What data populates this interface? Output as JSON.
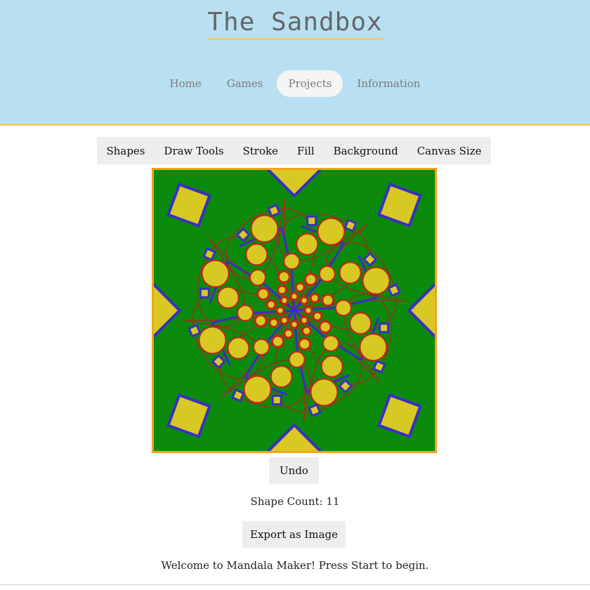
{
  "header": {
    "title": "The Sandbox",
    "nav": [
      {
        "label": "Home",
        "active": false
      },
      {
        "label": "Games",
        "active": false
      },
      {
        "label": "Projects",
        "active": true
      },
      {
        "label": "Information",
        "active": false
      }
    ]
  },
  "toolbar": {
    "items": [
      "Shapes",
      "Draw Tools",
      "Stroke",
      "Fill",
      "Background",
      "Canvas Size"
    ]
  },
  "canvas": {
    "background_color": "#0b8a0b",
    "fill_color": "#d8c823",
    "stroke_colors": [
      "#3a2fc0",
      "#c4231a",
      "#8b3a1a"
    ],
    "symmetry_count": 8
  },
  "undo_label": "Undo",
  "shape_count_text": "Shape Count: 11",
  "export_label": "Export as Image",
  "status_text": "Welcome to Mandala Maker! Press Start to begin."
}
